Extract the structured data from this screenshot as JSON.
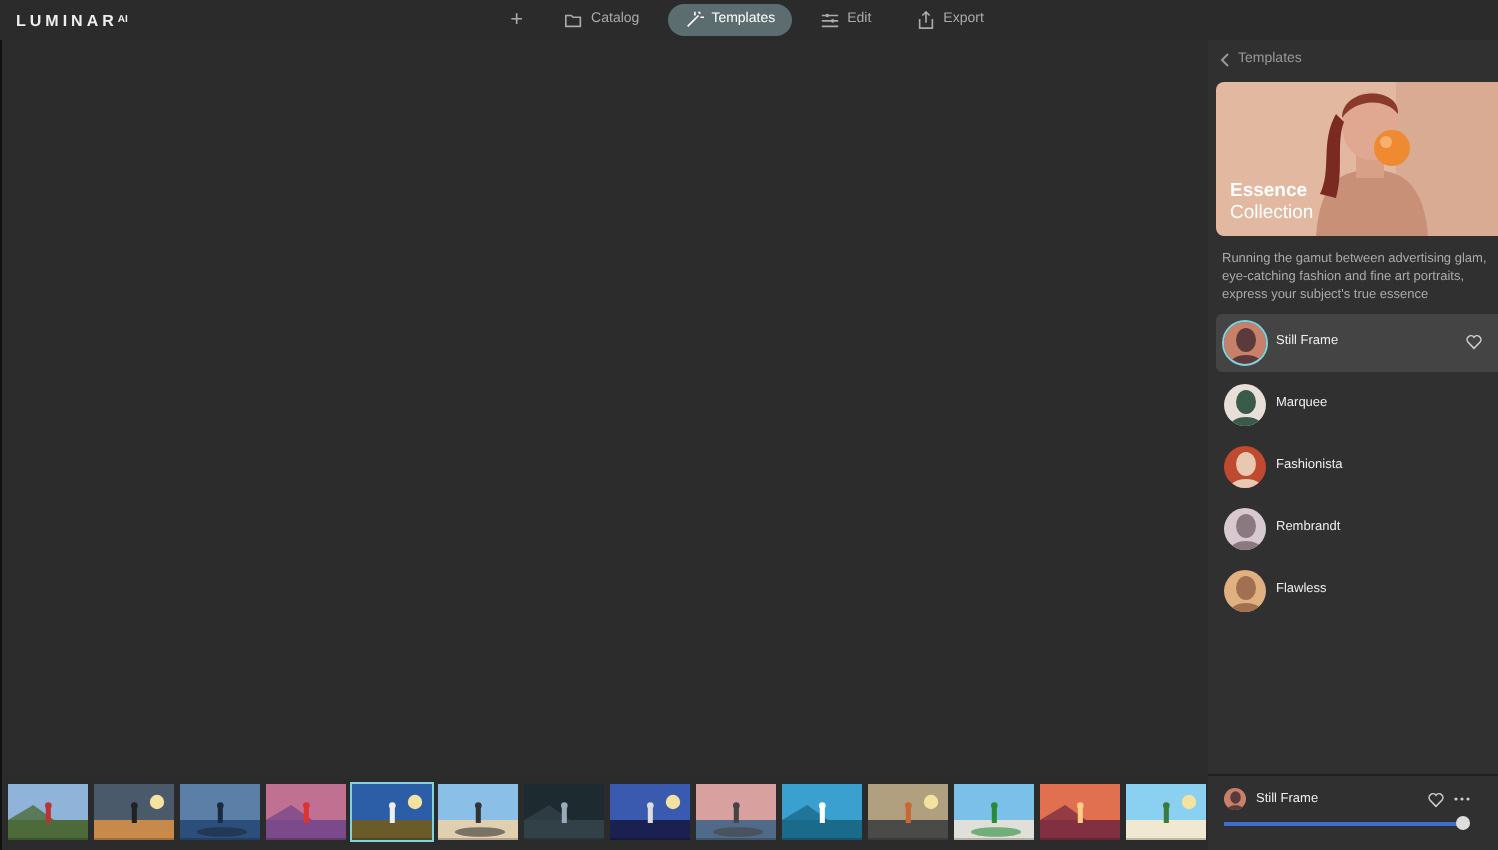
{
  "app": {
    "logo": "LUMINAR",
    "logo_suffix": "AI"
  },
  "toolbar": {
    "add": "+",
    "tabs": [
      {
        "label": "Catalog",
        "selected": false
      },
      {
        "label": "Templates",
        "selected": true
      },
      {
        "label": "Edit",
        "selected": false
      },
      {
        "label": "Export",
        "selected": false
      }
    ]
  },
  "panel": {
    "back": "Templates",
    "collection": {
      "kind": "picture",
      "title": "Essence",
      "subtitle": "Collection"
    },
    "description": "Running the gamut between advertising glam, eye-catching fashion and fine art portraits, express your subject's true essence",
    "templates": [
      {
        "name": "Still Frame",
        "selected": true
      },
      {
        "name": "Marquee",
        "selected": false
      },
      {
        "name": "Fashionista",
        "selected": false
      },
      {
        "name": "Rembrandt",
        "selected": false
      },
      {
        "name": "Flawless",
        "selected": false
      }
    ]
  },
  "filmstrip": [
    {
      "kind": "picture",
      "selected": false
    },
    {
      "kind": "picture",
      "selected": false
    },
    {
      "kind": "picture",
      "selected": false
    },
    {
      "kind": "picture",
      "selected": false
    },
    {
      "kind": "picture",
      "selected": true
    },
    {
      "kind": "picture",
      "selected": false
    },
    {
      "kind": "picture",
      "selected": false
    },
    {
      "kind": "picture",
      "selected": false
    },
    {
      "kind": "picture",
      "selected": false
    },
    {
      "kind": "picture",
      "selected": false
    },
    {
      "kind": "picture",
      "selected": false
    },
    {
      "kind": "picture",
      "selected": false
    },
    {
      "kind": "picture",
      "selected": false
    },
    {
      "kind": "picture",
      "selected": false
    }
  ],
  "footer": {
    "template": "Still Frame",
    "level": 0.97
  }
}
